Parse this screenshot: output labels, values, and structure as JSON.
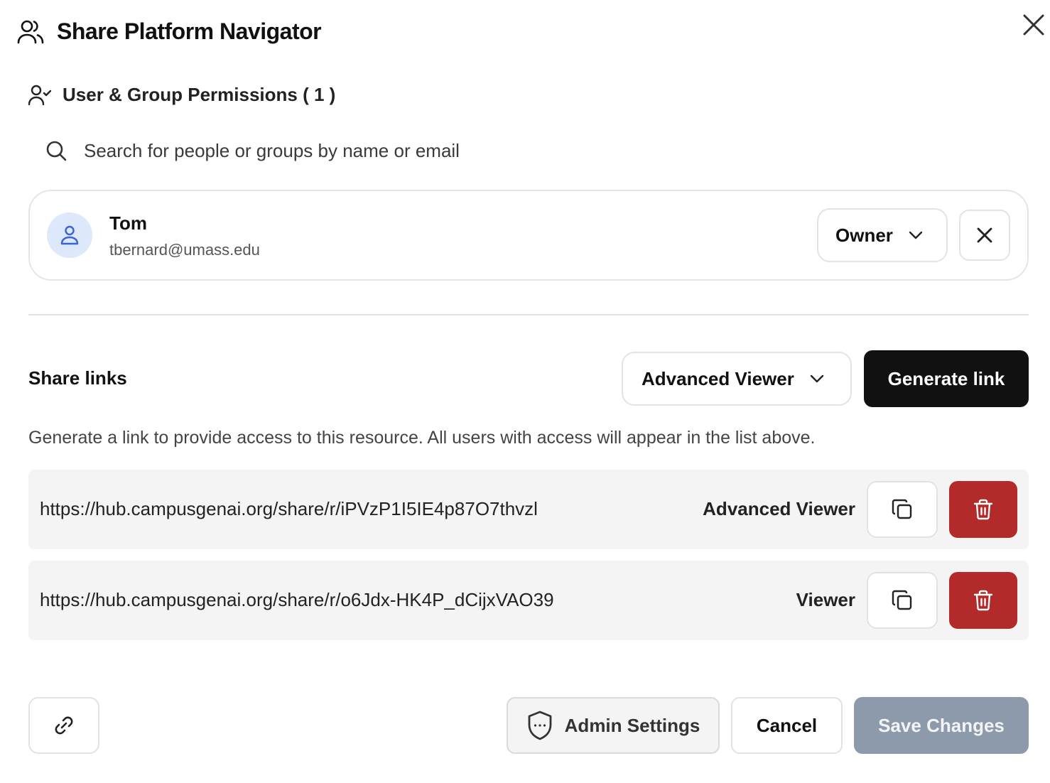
{
  "dialog": {
    "title": "Share Platform Navigator",
    "title_icon": "users-icon",
    "close_icon": "close-icon"
  },
  "permissions": {
    "label": "User & Group Permissions ( 1 )",
    "icon": "user-check-icon",
    "search_placeholder": "Search for people or groups by name or email",
    "users": [
      {
        "name": "Tom",
        "email": "tbernard@umass.edu",
        "role": "Owner",
        "avatar_icon": "user-icon",
        "avatar_color": "#dde8fb",
        "avatar_icon_color": "#3b63d9"
      }
    ]
  },
  "share_links": {
    "title": "Share links",
    "selected_role": "Advanced Viewer",
    "generate_label": "Generate link",
    "description": "Generate a link to provide access to this resource. All users with access will appear in the list above.",
    "links": [
      {
        "url": "https://hub.campusgenai.org/share/r/iPVzP1I5IE4p87O7thvzl",
        "role": "Advanced Viewer"
      },
      {
        "url": "https://hub.campusgenai.org/share/r/o6Jdx-HK4P_dCijxVAO39",
        "role": "Viewer"
      }
    ]
  },
  "footer": {
    "link_icon": "link-icon",
    "admin_label": "Admin Settings",
    "admin_icon": "shield-icon",
    "cancel_label": "Cancel",
    "save_label": "Save Changes"
  },
  "colors": {
    "primary_button": "#111111",
    "delete_button": "#b22a2a",
    "save_disabled": "#8c9aab"
  }
}
